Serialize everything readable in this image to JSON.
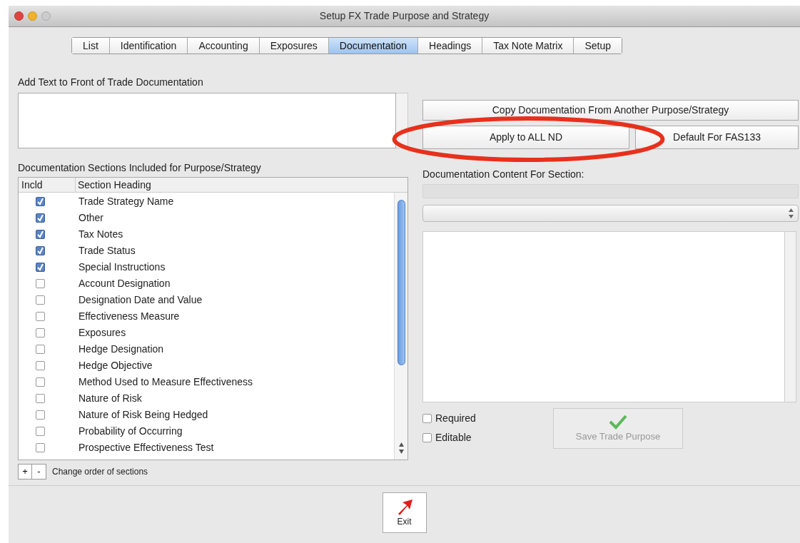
{
  "window": {
    "title": "Setup FX Trade Purpose and Strategy"
  },
  "tabs": [
    {
      "label": "List",
      "selected": false
    },
    {
      "label": "Identification",
      "selected": false
    },
    {
      "label": "Accounting",
      "selected": false
    },
    {
      "label": "Exposures",
      "selected": false
    },
    {
      "label": "Documentation",
      "selected": true
    },
    {
      "label": "Headings",
      "selected": false
    },
    {
      "label": "Tax Note Matrix",
      "selected": false
    },
    {
      "label": "Setup",
      "selected": false
    }
  ],
  "front_text": {
    "label": "Add Text to Front of Trade Documentation"
  },
  "buttons": {
    "copy": "Copy Documentation From Another Purpose/Strategy",
    "apply": "Apply to ALL ND",
    "default": "Default For FAS133"
  },
  "sections": {
    "label": "Documentation Sections Included for Purpose/Strategy",
    "columns": [
      "Incld",
      "Section Heading"
    ],
    "rows": [
      {
        "heading": "Trade Strategy Name",
        "checked": true
      },
      {
        "heading": "Other",
        "checked": true
      },
      {
        "heading": "Tax Notes",
        "checked": true
      },
      {
        "heading": "Trade Status",
        "checked": true
      },
      {
        "heading": "Special Instructions",
        "checked": true
      },
      {
        "heading": "Account Designation",
        "checked": false
      },
      {
        "heading": "Designation Date and Value",
        "checked": false
      },
      {
        "heading": "Effectiveness Measure",
        "checked": false
      },
      {
        "heading": "Exposures",
        "checked": false
      },
      {
        "heading": "Hedge Designation",
        "checked": false
      },
      {
        "heading": "Hedge Objective",
        "checked": false
      },
      {
        "heading": "Method Used to Measure Effectiveness",
        "checked": false
      },
      {
        "heading": "Nature of Risk",
        "checked": false
      },
      {
        "heading": "Nature of Risk Being Hedged",
        "checked": false
      },
      {
        "heading": "Probability of Occurring",
        "checked": false
      },
      {
        "heading": "Prospective Effectiveness Test",
        "checked": false
      }
    ],
    "add": "+",
    "remove": "-",
    "order_label": "Change order of sections"
  },
  "content": {
    "label": "Documentation Content For Section:",
    "options": [
      {
        "label": "Required",
        "checked": false
      },
      {
        "label": "Editable",
        "checked": false
      }
    ],
    "save": {
      "label": "Save Trade Purpose",
      "disabled": true
    }
  },
  "exit": {
    "label": "Exit"
  }
}
